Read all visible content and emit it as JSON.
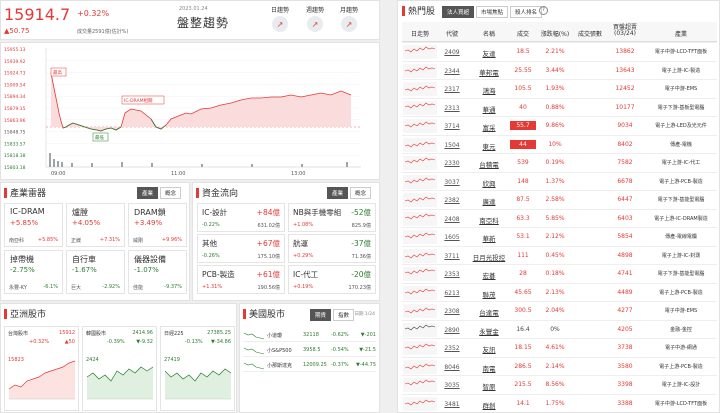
{
  "index": {
    "value": "15914.7",
    "pct": "+0.32%",
    "change": "▲50.75",
    "volume": "成交量2591億(估計%)",
    "trend_label": "盤整趨勢",
    "date": "2023.01.24",
    "trends": [
      {
        "label": "日趨勢"
      },
      {
        "label": "週趨勢"
      },
      {
        "label": "月趨勢"
      }
    ]
  },
  "main_chart": {
    "y_ticks": [
      "15955.13",
      "15939.92",
      "15924.73",
      "15909.54",
      "15894.34",
      "15879.15",
      "15863.96",
      "15848.75",
      "15833.57",
      "15818.38",
      "15803.18"
    ],
    "x_ticks": [
      "09:00",
      "11:00",
      "13:00"
    ],
    "labels": [
      "最高",
      "IC-DRAM相關",
      "最低"
    ]
  },
  "industry": {
    "title": "產業雷器",
    "tabs": [
      "產業",
      "概念"
    ],
    "cards": [
      {
        "name": "IC-DRAM",
        "pct": "+5.85%",
        "sub_label": "南亞科",
        "sub_pct": "+5.85%",
        "color": "red"
      },
      {
        "name": "爐膛",
        "pct": "+4.05%",
        "sub_label": "正崴",
        "sub_pct": "+7.31%",
        "color": "red"
      },
      {
        "name": "DRAM鎖",
        "pct": "+3.49%",
        "sub_label": "威剛",
        "sub_pct": "+9.96%",
        "color": "red"
      },
      {
        "name": "掉帶機",
        "pct": "-2.75%",
        "sub_label": "永豐-KY",
        "sub_pct": "-6.1%",
        "color": "green"
      },
      {
        "name": "自行車",
        "pct": "-1.67%",
        "sub_label": "巨大",
        "sub_pct": "-2.92%",
        "color": "green"
      },
      {
        "name": "儀器設備",
        "pct": "-1.07%",
        "sub_label": "佳能",
        "sub_pct": "-9.37%",
        "color": "green"
      }
    ]
  },
  "fund": {
    "title": "資金流向",
    "tabs": [
      "產業",
      "概念"
    ],
    "cards": [
      {
        "name": "IC-設計",
        "amount": "+84億",
        "pct": "-0.22%",
        "total": "631.02億",
        "color": "red"
      },
      {
        "name": "NB與手機零組",
        "amount": "-52億",
        "pct": "+1.08%",
        "total": "825.9億",
        "color": "green"
      },
      {
        "name": "其他",
        "amount": "+67億",
        "pct": "-0.26%",
        "total": "175.10億",
        "color": "red"
      },
      {
        "name": "航運",
        "amount": "-37億",
        "pct": "+0.29%",
        "total": "71.36億",
        "color": "green"
      },
      {
        "name": "PCB-製造",
        "amount": "+61億",
        "pct": "+1.31%",
        "total": "190.56億",
        "color": "red"
      },
      {
        "name": "IC-代工",
        "amount": "-20億",
        "pct": "+0.19%",
        "total": "170.23億",
        "color": "green"
      }
    ]
  },
  "asia": {
    "title": "亞洲股市",
    "markets": [
      {
        "name": "台灣股市",
        "value": "15912",
        "pct": "+0.32%",
        "chg": "▲50",
        "low": "15823",
        "color": "red"
      },
      {
        "name": "韓國股市",
        "value": "2414.96",
        "pct": "-0.39%",
        "chg": "▼-9.32",
        "low": "2424",
        "color": "green"
      },
      {
        "name": "日經225",
        "value": "27385.25",
        "pct": "-0.13%",
        "chg": "▼-34.86",
        "low": "27419",
        "color": "green"
      }
    ]
  },
  "us": {
    "title": "美國股市",
    "tabs": [
      "期貨",
      "指數"
    ],
    "date": "日期 1/24",
    "rows": [
      {
        "name": "小道瓊",
        "value": "32118",
        "pct": "-0.62%",
        "chg": "▼-201",
        "color": "green"
      },
      {
        "name": "小S&P500",
        "value": "3958.5",
        "pct": "-0.54%",
        "chg": "▼-21.5",
        "color": "green"
      },
      {
        "name": "小那斯達克",
        "value": "12009.25",
        "pct": "-0.37%",
        "chg": "▼-44.75",
        "color": "green"
      }
    ]
  },
  "hot": {
    "title": "熱門股",
    "tabs": [
      "法人買超",
      "市場焦點",
      "殺人排名"
    ],
    "help": "?",
    "headers": [
      "日走勢",
      "代號",
      "名稱",
      "成交",
      "漲跌幅(%)",
      "成交張數",
      "買盤超賣(03/24)",
      "產業"
    ],
    "rows": [
      {
        "code": "2409",
        "name": "友達",
        "price": "18.5",
        "pct": "2.21%",
        "vol": "13862",
        "ind": "電子中游-LCD-TFT面板",
        "c": "red"
      },
      {
        "code": "2344",
        "name": "華邦電",
        "price": "25.55",
        "pct": "3.44%",
        "vol": "13643",
        "ind": "電子上游-IC-製造",
        "c": "red"
      },
      {
        "code": "2317",
        "name": "鴻海",
        "price": "105.5",
        "pct": "1.93%",
        "vol": "12452",
        "ind": "電子中游-EMS",
        "c": "red"
      },
      {
        "code": "2313",
        "name": "華通",
        "price": "40",
        "pct": "0.88%",
        "vol": "10177",
        "ind": "電子下游-基板型電腦",
        "c": "red"
      },
      {
        "code": "3714",
        "name": "富采",
        "price": "55.7",
        "pct": "9.86%",
        "vol": "9034",
        "ind": "電子上游-LED及光元件",
        "c": "red",
        "box": true
      },
      {
        "code": "1504",
        "name": "東元",
        "price": "44",
        "pct": "10%",
        "vol": "8402",
        "ind": "傳產-電機",
        "c": "red",
        "box": true
      },
      {
        "code": "2330",
        "name": "台積電",
        "price": "539",
        "pct": "0.19%",
        "vol": "7582",
        "ind": "電子上游-IC-代工",
        "c": "red"
      },
      {
        "code": "3037",
        "name": "欣興",
        "price": "148",
        "pct": "1.37%",
        "vol": "6678",
        "ind": "電子上游-PCB-製造",
        "c": "red"
      },
      {
        "code": "2382",
        "name": "廣達",
        "price": "87.5",
        "price_c": "red",
        "pct": "2.58%",
        "vol": "6447",
        "ind": "電子下游-基能型電腦",
        "c": "red"
      },
      {
        "code": "2408",
        "name": "南亞科",
        "price": "63.3",
        "pct": "5.85%",
        "vol": "6403",
        "ind": "電子上游-IC-DRAM製造",
        "c": "red"
      },
      {
        "code": "1605",
        "name": "華新",
        "price": "53.1",
        "pct": "2.12%",
        "vol": "5854",
        "ind": "傳產-電線電纜",
        "c": "red"
      },
      {
        "code": "3711",
        "name": "日月光投控",
        "price": "111",
        "pct": "0.45%",
        "vol": "4898",
        "ind": "電子上游-IC-封測",
        "c": "red"
      },
      {
        "code": "2353",
        "name": "宏碁",
        "price": "28",
        "pct": "0.18%",
        "vol": "4741",
        "ind": "電子下游-基能型電腦",
        "c": "red"
      },
      {
        "code": "6213",
        "name": "聯茂",
        "price": "45.65",
        "pct": "2.13%",
        "vol": "4489",
        "ind": "電子上游-PCB-製造",
        "c": "red"
      },
      {
        "code": "2308",
        "name": "台達電",
        "price": "300.5",
        "pct": "2.04%",
        "vol": "4277",
        "ind": "電子中游-EMS",
        "c": "red"
      },
      {
        "code": "2890",
        "name": "永豐金",
        "price": "16.4",
        "pct": "0%",
        "vol": "4205",
        "ind": "金融-金控",
        "c": "gray"
      },
      {
        "code": "2352",
        "name": "友訊",
        "price": "18.15",
        "pct": "4.61%",
        "vol": "3738",
        "ind": "電子中游-網通",
        "c": "red"
      },
      {
        "code": "8046",
        "name": "南電",
        "price": "286.5",
        "pct": "2.14%",
        "vol": "3580",
        "ind": "電子上游-PCB-製造",
        "c": "red"
      },
      {
        "code": "3035",
        "name": "智原",
        "price": "215.5",
        "pct": "8.56%",
        "vol": "3398",
        "ind": "電子上游-IC-設計",
        "c": "red"
      },
      {
        "code": "3481",
        "name": "群創",
        "price": "14.1",
        "pct": "1.75%",
        "vol": "3388",
        "ind": "電子中游-LCD-TFT面板",
        "c": "red"
      }
    ]
  },
  "colors": {
    "up": "#e53935",
    "down": "#2e7d32",
    "accent": "#e53935"
  }
}
